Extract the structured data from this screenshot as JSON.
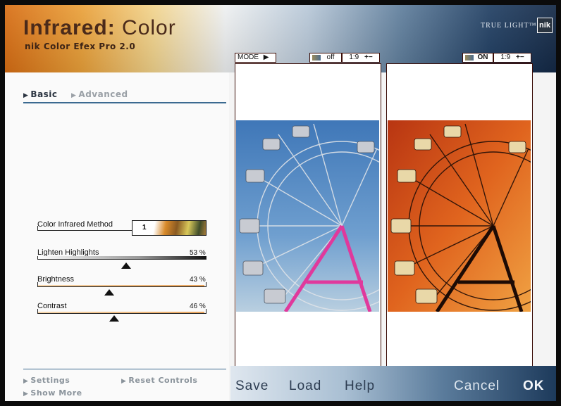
{
  "header": {
    "title_main": "Infrared:",
    "title_sub": "Color",
    "subtitle": "nik Color Efex Pro 2.0",
    "brand": "TRUE LIGHT™",
    "brand_logo": "nik"
  },
  "tabs": {
    "basic": "Basic",
    "advanced": "Advanced"
  },
  "controls": {
    "method": {
      "label": "Color Infrared Method",
      "value": "1"
    },
    "lighten": {
      "label": "Lighten Highlights",
      "value": "53 %",
      "level": 0.53
    },
    "brightness": {
      "label": "Brightness",
      "value": "43 %",
      "level": 0.43
    },
    "contrast": {
      "label": "Contrast",
      "value": "46 %",
      "level": 0.46
    }
  },
  "links": {
    "settings": "Settings",
    "reset": "Reset Controls",
    "show_more": "Show More"
  },
  "preview_left": {
    "mode": "MODE",
    "state": "off",
    "zoom": "1:9",
    "zoom_ctrl": "+−"
  },
  "preview_right": {
    "state": "ON",
    "zoom": "1:9",
    "zoom_ctrl": "+−"
  },
  "footer": {
    "save": "Save",
    "load": "Load",
    "help": "Help",
    "cancel": "Cancel",
    "ok": "OK"
  },
  "icons": {
    "mode_arrow": "triangle-right-icon",
    "histogram": "histogram-icon",
    "tab_arrow": "triangle-right-icon"
  },
  "colors": {
    "accent": "#3b6a90",
    "frame_border": "#3b0d07"
  }
}
